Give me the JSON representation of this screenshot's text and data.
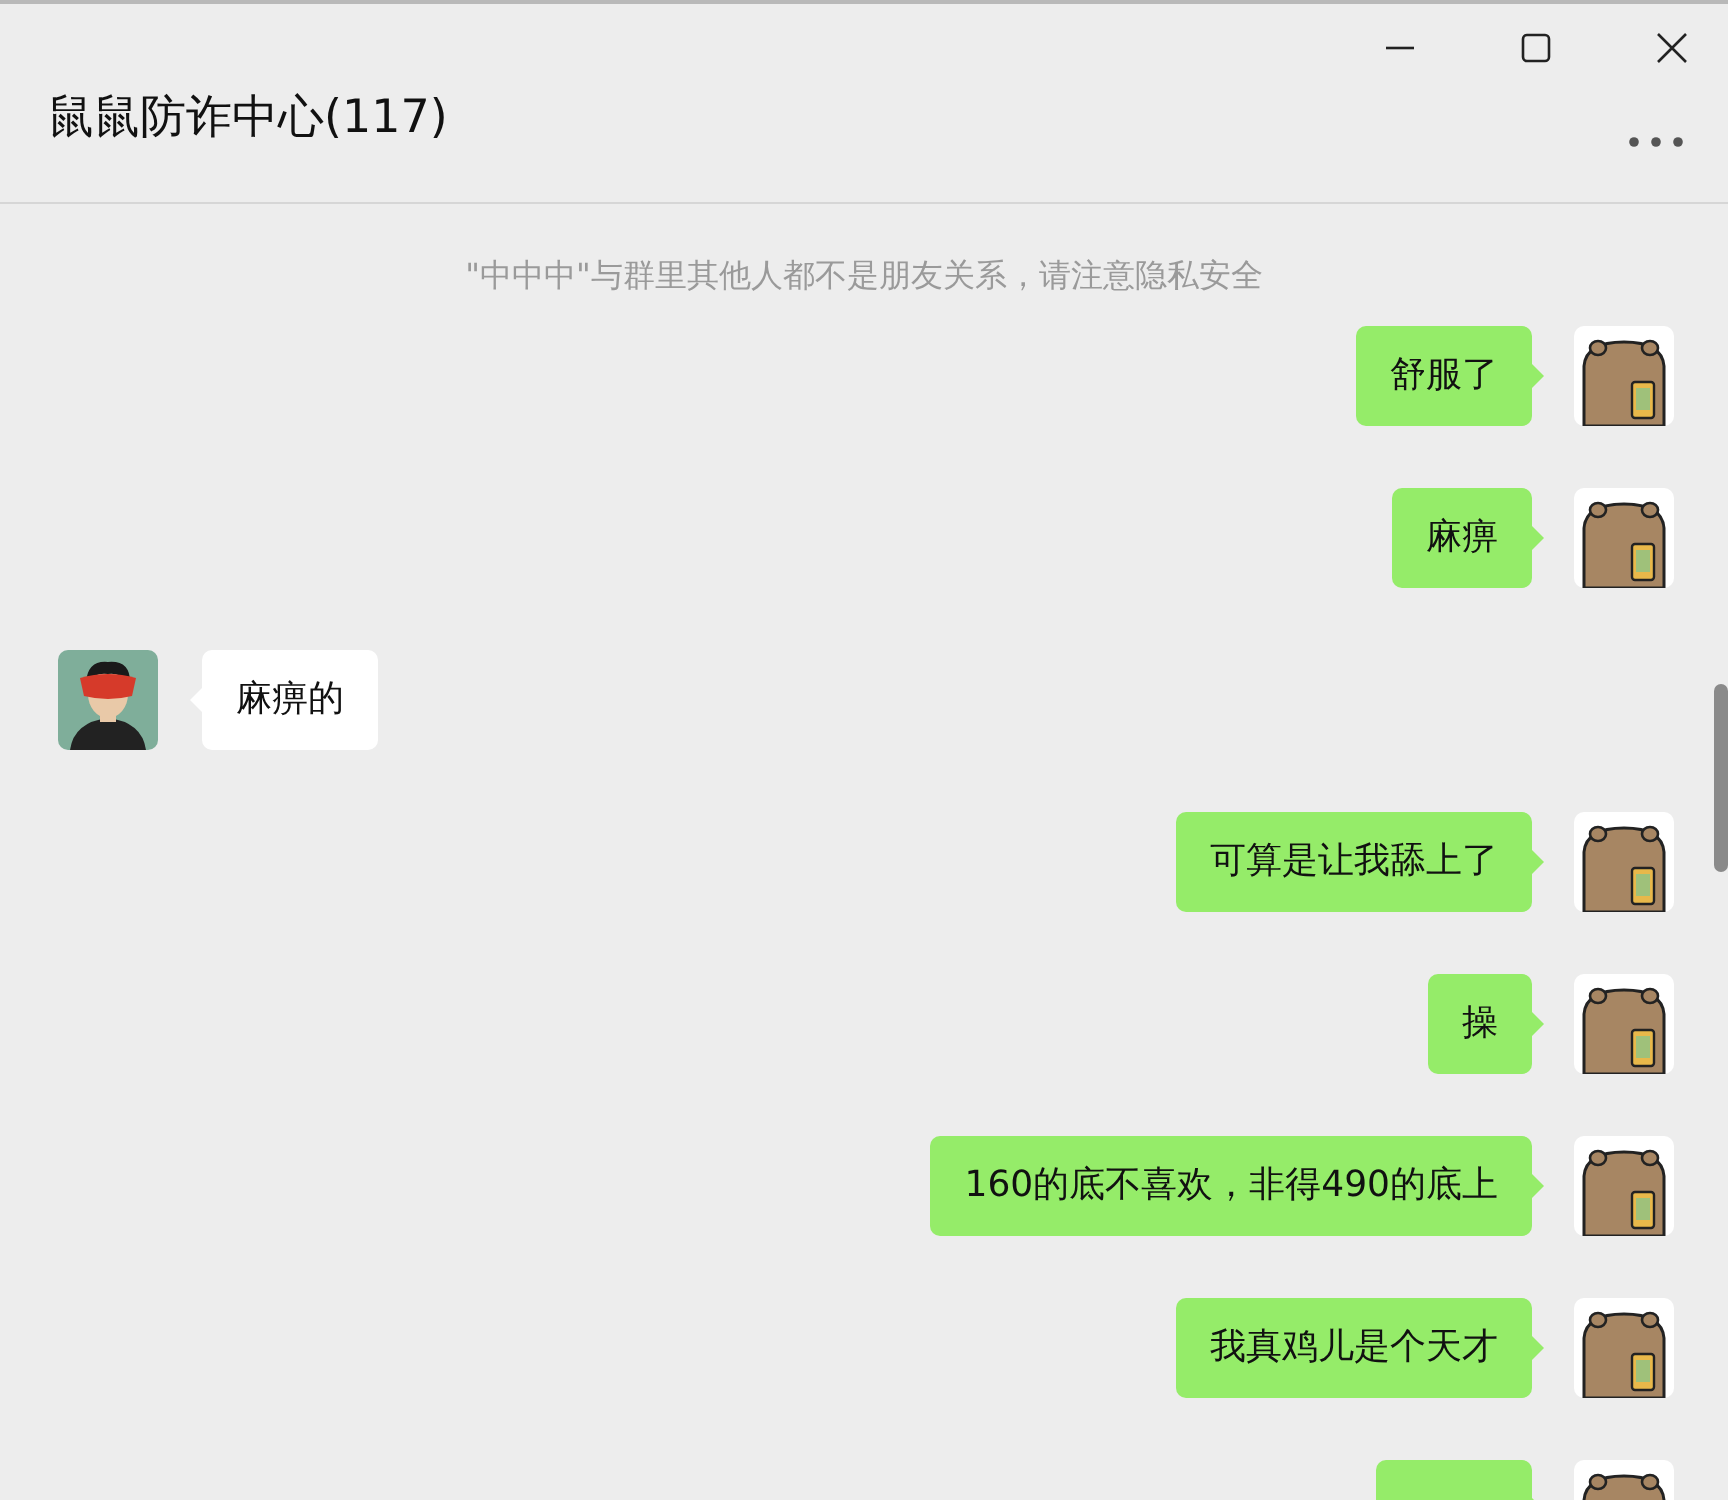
{
  "window": {
    "title": "鼠鼠防诈中心(117)"
  },
  "notice": "\"中中中\"与群里其他人都不是朋友关系，请注意隐私安全",
  "messages": [
    {
      "kind": "sent",
      "text": "舒服了"
    },
    {
      "kind": "sent",
      "text": "麻痹"
    },
    {
      "kind": "received",
      "text": "麻痹的"
    },
    {
      "kind": "sent",
      "text": "可算是让我舔上了"
    },
    {
      "kind": "sent",
      "text": "操"
    },
    {
      "kind": "sent",
      "text": "160的底不喜欢，非得490的底上"
    },
    {
      "kind": "sent",
      "text": "我真鸡儿是个天才"
    },
    {
      "kind": "sent"
    }
  ]
}
